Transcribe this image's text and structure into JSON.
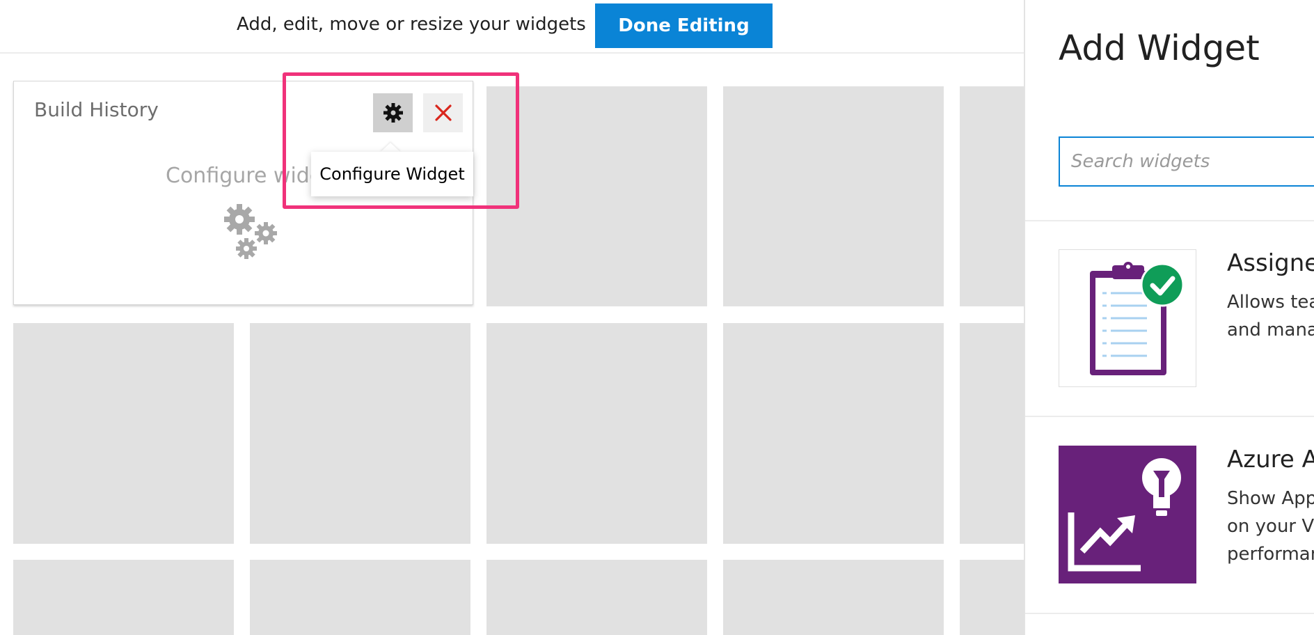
{
  "edit_bar": {
    "instructions": "Add, edit, move or resize your widgets",
    "done_button_label": "Done Editing"
  },
  "widget": {
    "title": "Build History",
    "configure_prompt": "Configure widg",
    "tooltip": "Configure Widget",
    "close_glyph": "✕"
  },
  "panel": {
    "title": "Add Widget",
    "search_placeholder": "Search widgets",
    "items": [
      {
        "name": "Assigne",
        "description_lines": [
          "Allows tea",
          "and mana"
        ],
        "icon": "clipboard-check-icon"
      },
      {
        "name": "Azure A",
        "description_lines": [
          "Show App",
          "on your VS",
          "performan"
        ],
        "icon": "lightbulb-chart-icon"
      }
    ]
  },
  "colors": {
    "accent_blue": "#0a84d6",
    "highlight_pink": "#f0327a",
    "placeholder_gray": "#e1e1e1",
    "close_red": "#d9261c",
    "purple": "#68217a",
    "check_green": "#0f9d58"
  }
}
